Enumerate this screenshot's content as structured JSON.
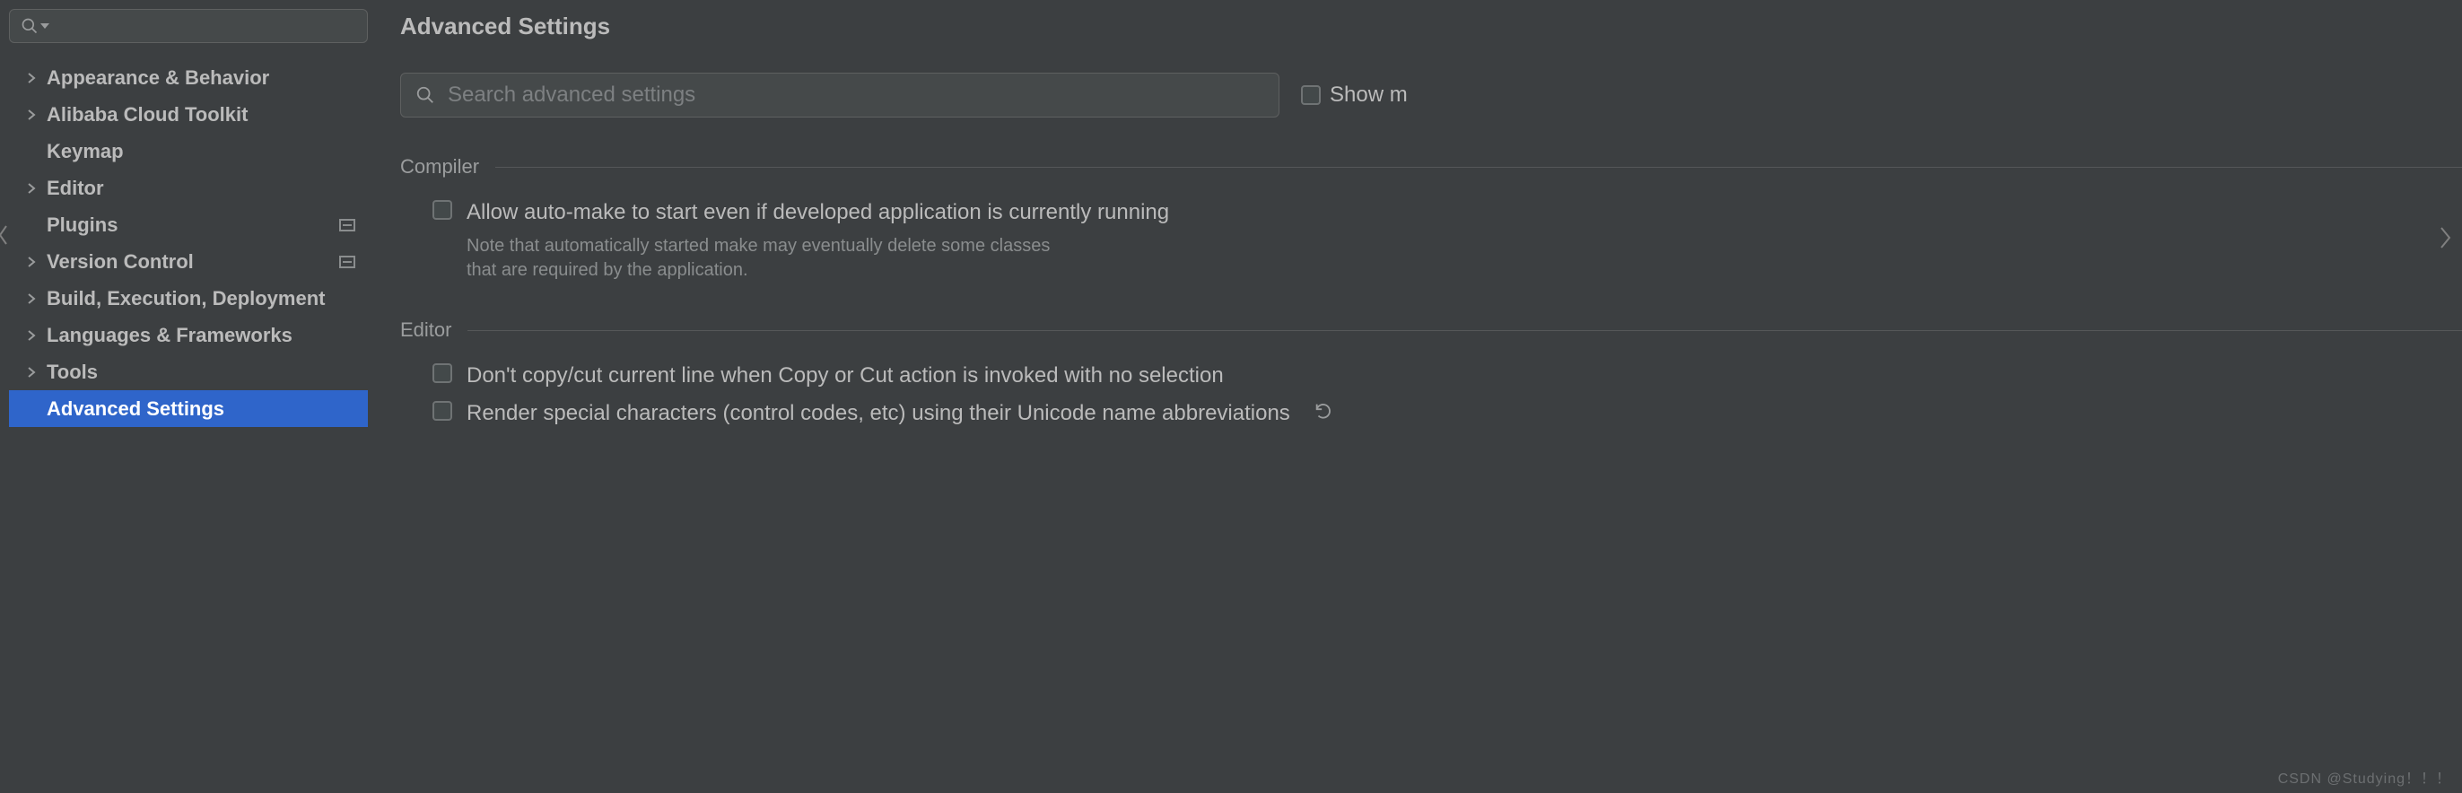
{
  "sidebar": {
    "items": [
      {
        "label": "Appearance & Behavior",
        "expandable": true
      },
      {
        "label": "Alibaba Cloud Toolkit",
        "expandable": true
      },
      {
        "label": "Keymap",
        "expandable": false
      },
      {
        "label": "Editor",
        "expandable": true
      },
      {
        "label": "Plugins",
        "expandable": false,
        "trailing": true
      },
      {
        "label": "Version Control",
        "expandable": true,
        "trailing": true
      },
      {
        "label": "Build, Execution, Deployment",
        "expandable": true
      },
      {
        "label": "Languages & Frameworks",
        "expandable": true
      },
      {
        "label": "Tools",
        "expandable": true
      },
      {
        "label": "Advanced Settings",
        "expandable": false,
        "selected": true
      }
    ]
  },
  "main": {
    "title": "Advanced Settings",
    "search_placeholder": "Search advanced settings",
    "show_modified_label": "Show m",
    "sections": {
      "compiler": {
        "title": "Compiler",
        "opt1": "Allow auto-make to start even if developed application is currently running",
        "note1a": "Note that automatically started make may eventually delete some classes",
        "note1b": "that are required by the application."
      },
      "editor": {
        "title": "Editor",
        "opt1": "Don't copy/cut current line when Copy or Cut action is invoked with no selection",
        "opt2": "Render special characters (control codes, etc) using their Unicode name abbreviations"
      }
    }
  },
  "watermark": "CSDN @Studying！！！"
}
